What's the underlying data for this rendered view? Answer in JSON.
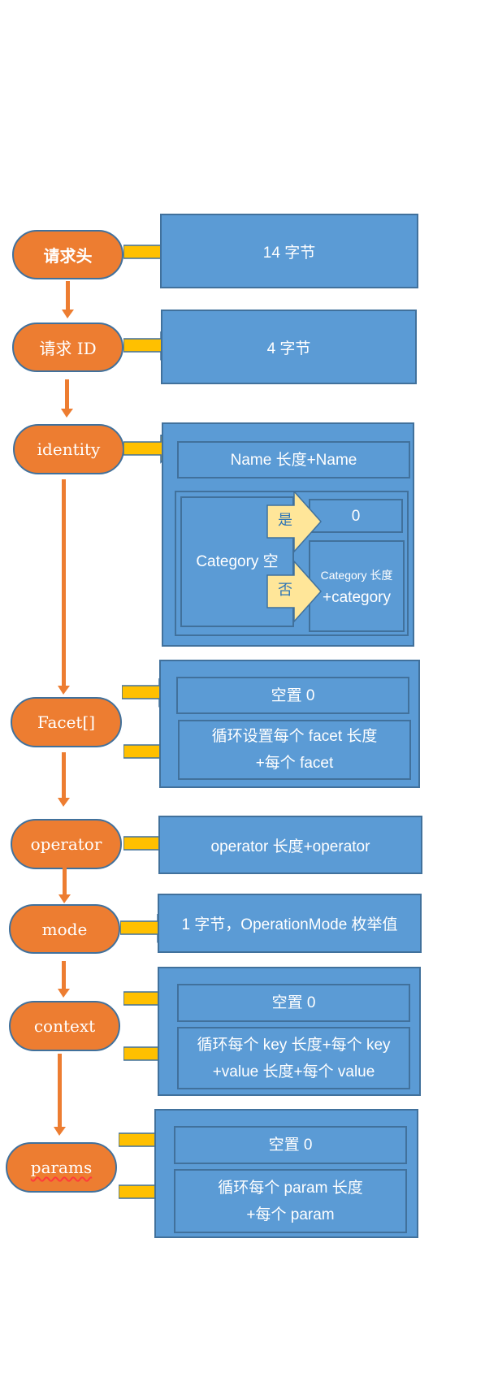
{
  "steps": {
    "header": {
      "label": "请求头",
      "info": "14 字节"
    },
    "request_id": {
      "label": "请求 ID",
      "info": "4 字节"
    },
    "identity": {
      "label": "identity",
      "name_info": "Name 长度+Name",
      "category": "Category 空",
      "yes": "是",
      "no": "否",
      "yes_value": "0",
      "no_value_line1": "Category 长度",
      "no_value_line2": "+category"
    },
    "facet": {
      "label": "Facet[]",
      "empty": "空置 0",
      "loop_line1": "循环设置每个 facet 长度",
      "loop_line2": "+每个 facet"
    },
    "operator": {
      "label": "operator",
      "info": "operator 长度+operator"
    },
    "mode": {
      "label": "mode",
      "info": "1 字节，OperationMode 枚举值"
    },
    "context": {
      "label": "context",
      "empty": "空置 0",
      "loop_line1": "循环每个 key 长度+每个 key",
      "loop_line2": "+value 长度+每个 value"
    },
    "params": {
      "label": "params",
      "empty": "空置 0",
      "loop_line1": "循环每个 param 长度",
      "loop_line2": "+每个 param"
    }
  },
  "colors": {
    "orange": "#ED7D31",
    "blue": "#5B9BD5",
    "border": "#41719C",
    "arrow_yellow": "#FFC000",
    "decision_fill": "#FFE699"
  }
}
